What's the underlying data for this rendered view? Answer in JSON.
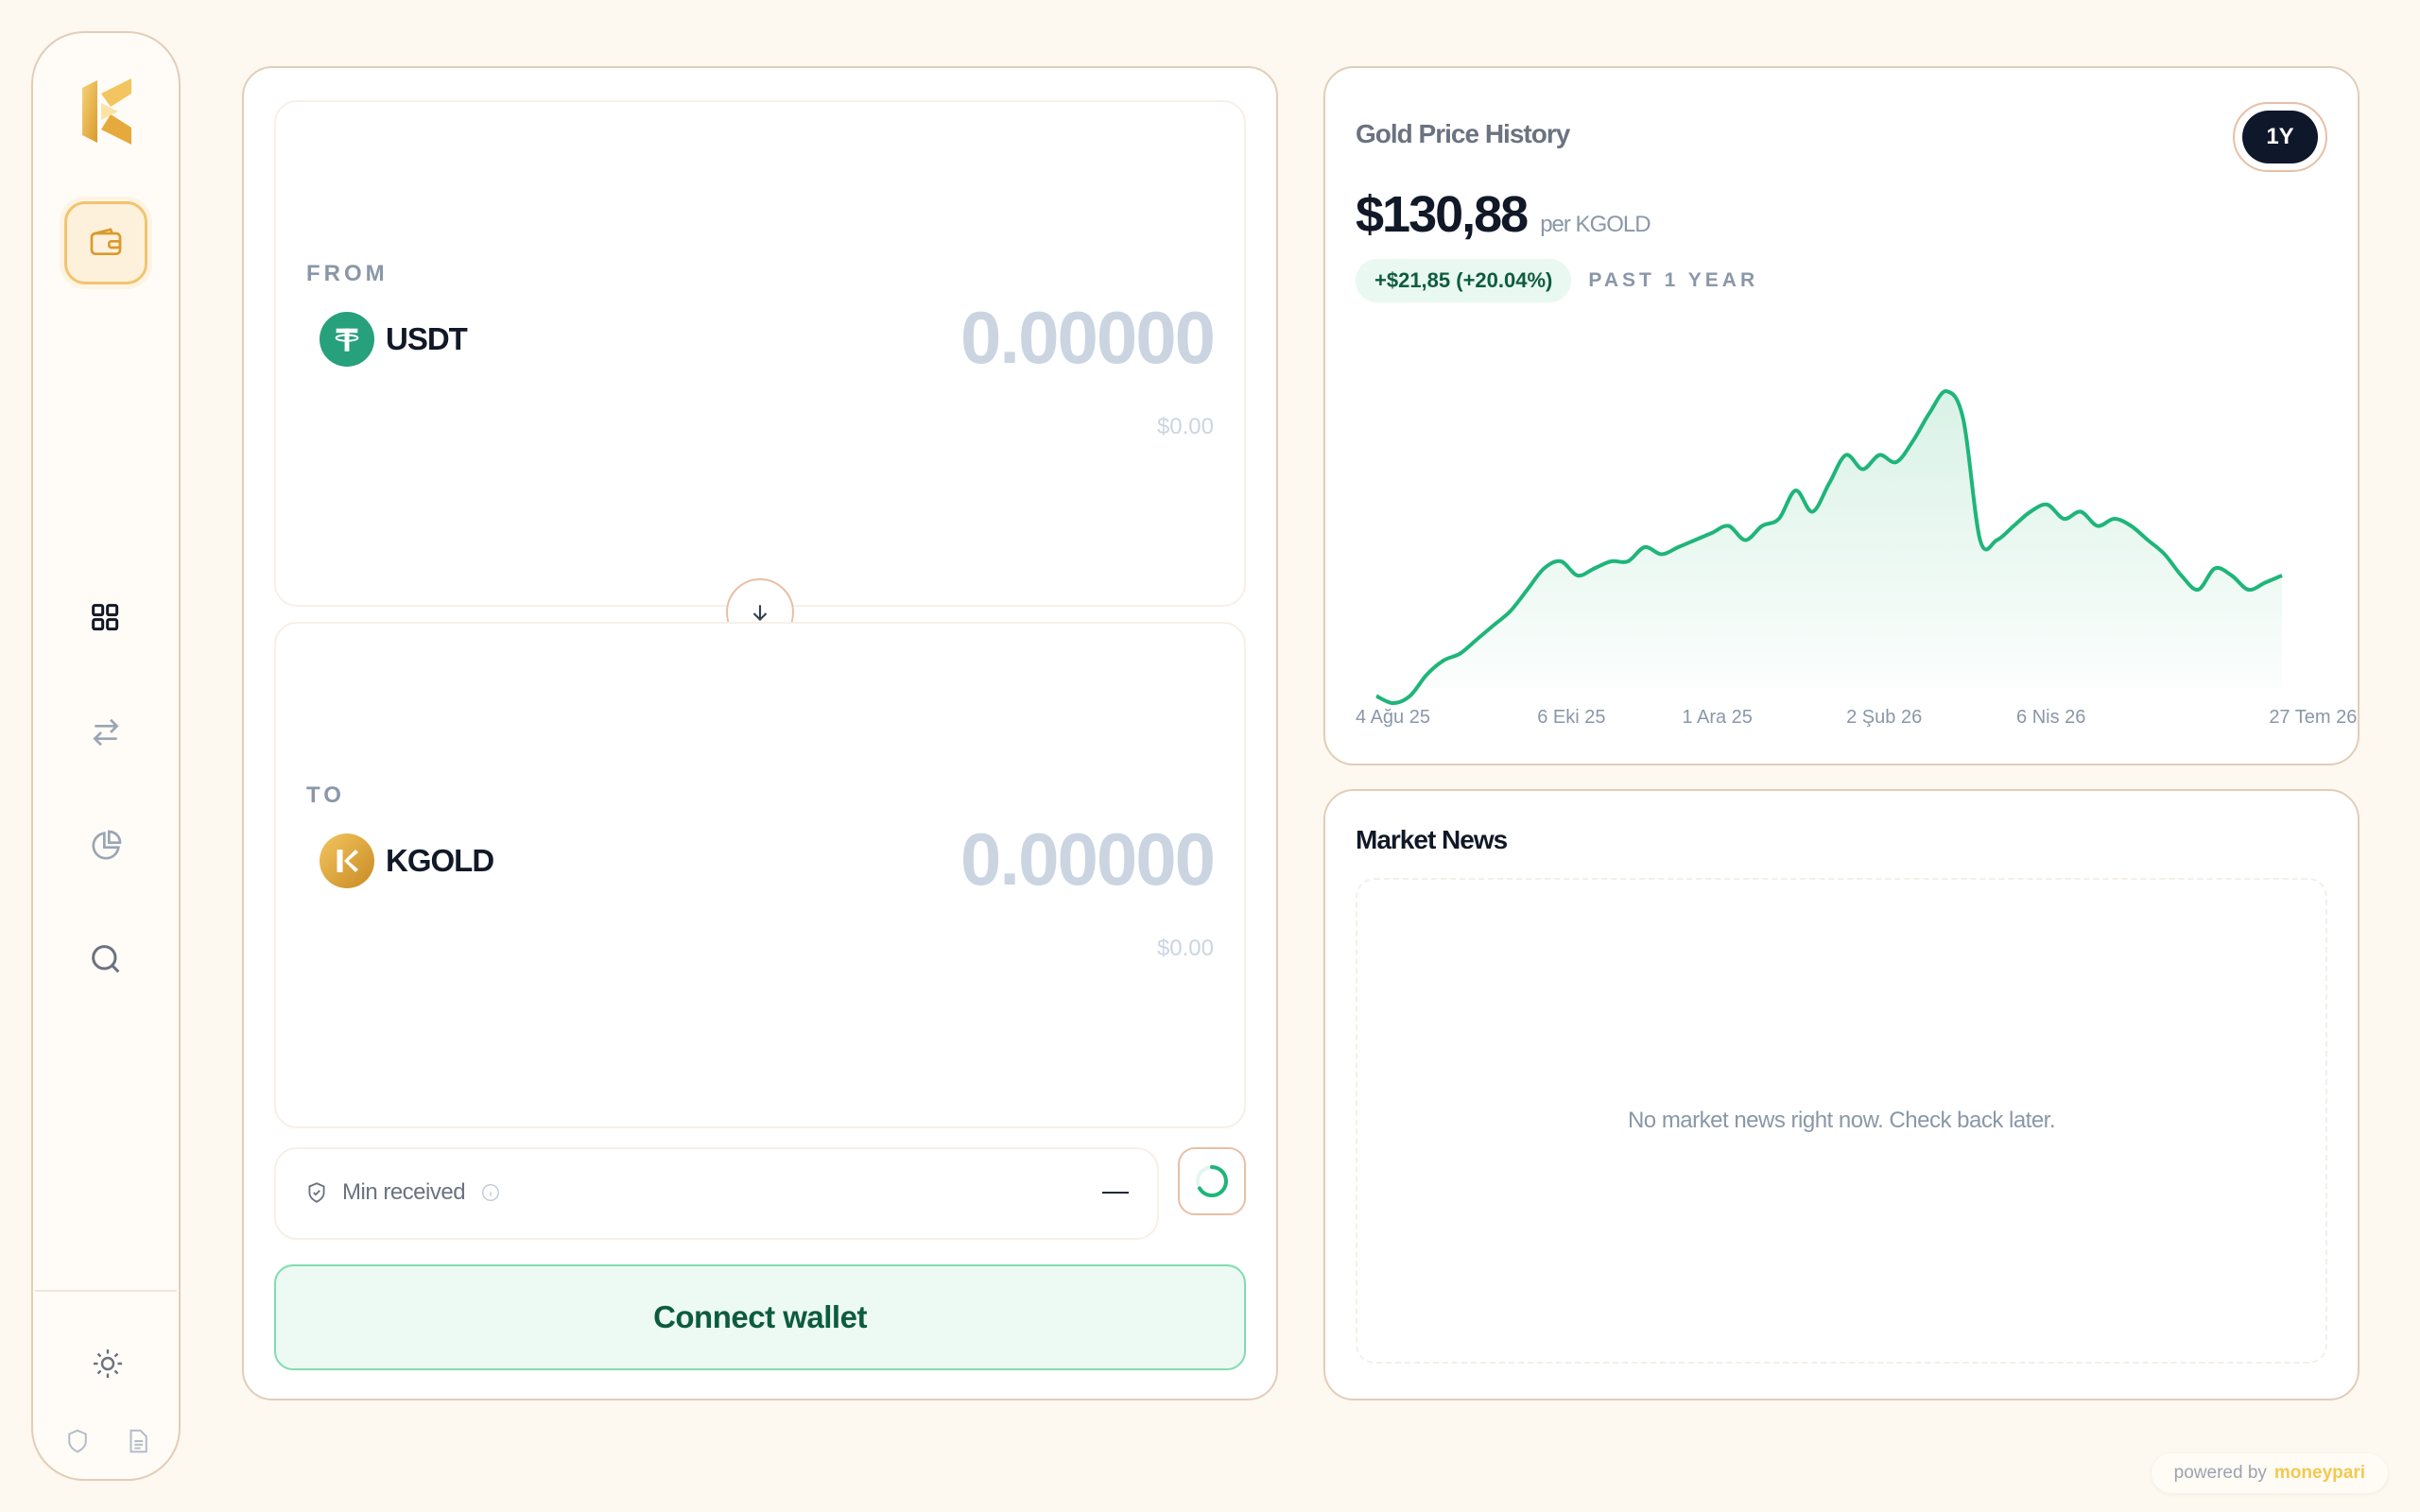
{
  "sidebar": {
    "logo": "kgold-logo",
    "nav": [
      {
        "name": "wallet",
        "icon": "wallet-icon",
        "active": true
      },
      {
        "name": "dashboard",
        "icon": "grid-icon",
        "active": false
      },
      {
        "name": "swap",
        "icon": "arrows-swap-icon",
        "active": false
      },
      {
        "name": "portfolio",
        "icon": "pie-chart-icon",
        "active": false
      },
      {
        "name": "search",
        "icon": "search-icon",
        "active": false
      }
    ],
    "bottom": [
      "sun-icon",
      "shield-icon",
      "document-icon"
    ]
  },
  "swap": {
    "from": {
      "label": "FROM",
      "token": "USDT",
      "amount": "0.00000",
      "usd": "$0.00"
    },
    "to": {
      "label": "TO",
      "token": "KGOLD",
      "amount": "0.00000",
      "usd": "$0.00"
    },
    "min_received": {
      "label": "Min received",
      "value": "—"
    },
    "connect_label": "Connect wallet"
  },
  "chart_panel": {
    "title": "Gold Price History",
    "range": "1Y",
    "price": "$130,88",
    "price_unit": "per KGOLD",
    "change": "+$21,85 (+20.04%)",
    "period": "PAST 1 YEAR"
  },
  "chart_data": {
    "type": "area",
    "title": "Gold Price History",
    "x_tick_labels": [
      "4 Ağu 25",
      "6 Eki 25",
      "1 Ara 25",
      "2 Şub 26",
      "6 Nis 26",
      "27 Tem 26"
    ],
    "y": [
      109,
      108,
      109,
      112,
      114,
      115,
      117,
      119,
      121,
      124,
      127,
      128,
      126,
      127,
      128,
      128,
      130,
      129,
      130,
      131,
      132,
      133,
      131,
      133,
      134,
      138,
      135,
      139,
      143,
      141,
      143,
      142,
      145,
      149,
      152,
      148,
      131,
      131,
      133,
      135,
      136,
      134,
      135,
      133,
      134,
      133,
      131,
      129,
      126,
      124,
      127,
      126,
      124,
      125,
      126
    ],
    "grid": false,
    "colors": {
      "line": "#1fb57a",
      "fill": "#d7f1e5"
    }
  },
  "news": {
    "title": "Market News",
    "empty": "No market news right now. Check back later."
  },
  "footer": {
    "powered_by": "powered by",
    "brand": "moneypari"
  }
}
